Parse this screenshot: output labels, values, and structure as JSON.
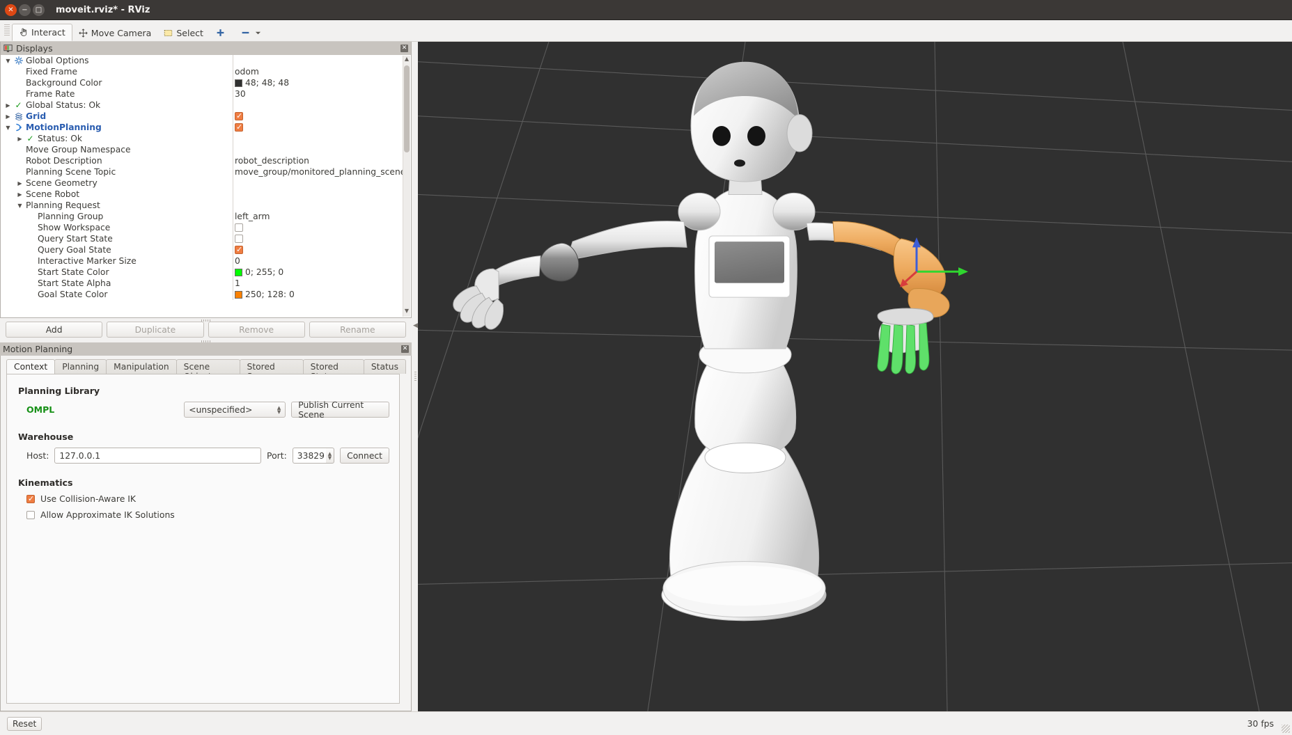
{
  "window": {
    "title": "moveit.rviz* - RViz",
    "close_icon": "close-icon",
    "minimize_icon": "minimize-icon",
    "maximize_icon": "maximize-icon"
  },
  "toolbar": {
    "items": [
      {
        "label": "Interact",
        "icon": "hand-cursor-icon",
        "active": true
      },
      {
        "label": "Move Camera",
        "icon": "move-camera-icon",
        "active": false
      },
      {
        "label": "Select",
        "icon": "select-rectangle-icon",
        "active": false
      },
      {
        "label": "",
        "icon": "plus-icon",
        "active": false
      },
      {
        "label": "",
        "icon": "minus-icon",
        "active": false
      }
    ]
  },
  "displays_panel": {
    "title": "Displays",
    "icon": "displays-icon",
    "close_icon": "close-icon",
    "rows": [
      {
        "indent": 0,
        "arrow": "down",
        "icon": "gear-icon",
        "label": "Global Options",
        "bold": false,
        "value_type": "none",
        "value": ""
      },
      {
        "indent": 1,
        "arrow": "none",
        "icon": "",
        "label": "Fixed Frame",
        "bold": false,
        "value_type": "text",
        "value": "odom"
      },
      {
        "indent": 1,
        "arrow": "none",
        "icon": "",
        "label": "Background Color",
        "bold": false,
        "value_type": "color",
        "value": "48; 48; 48",
        "color": "#303030"
      },
      {
        "indent": 1,
        "arrow": "none",
        "icon": "",
        "label": "Frame Rate",
        "bold": false,
        "value_type": "text",
        "value": "30"
      },
      {
        "indent": 0,
        "arrow": "right",
        "icon": "check-icon",
        "label": "Global Status: Ok",
        "bold": false,
        "value_type": "none",
        "value": ""
      },
      {
        "indent": 0,
        "arrow": "right",
        "icon": "grid-icon",
        "label": "Grid",
        "bold": true,
        "value_type": "checkbox",
        "value": "checked"
      },
      {
        "indent": 0,
        "arrow": "down",
        "icon": "motion-icon",
        "label": "MotionPlanning",
        "bold": true,
        "value_type": "checkbox",
        "value": "checked"
      },
      {
        "indent": 1,
        "arrow": "right",
        "icon": "check-icon",
        "label": "Status: Ok",
        "bold": false,
        "value_type": "none",
        "value": ""
      },
      {
        "indent": 1,
        "arrow": "none",
        "icon": "",
        "label": "Move Group Namespace",
        "bold": false,
        "value_type": "none",
        "value": ""
      },
      {
        "indent": 1,
        "arrow": "none",
        "icon": "",
        "label": "Robot Description",
        "bold": false,
        "value_type": "text",
        "value": "robot_description"
      },
      {
        "indent": 1,
        "arrow": "none",
        "icon": "",
        "label": "Planning Scene Topic",
        "bold": false,
        "value_type": "text",
        "value": "move_group/monitored_planning_scene"
      },
      {
        "indent": 1,
        "arrow": "right",
        "icon": "",
        "label": "Scene Geometry",
        "bold": false,
        "value_type": "none",
        "value": ""
      },
      {
        "indent": 1,
        "arrow": "right",
        "icon": "",
        "label": "Scene Robot",
        "bold": false,
        "value_type": "none",
        "value": ""
      },
      {
        "indent": 1,
        "arrow": "down",
        "icon": "",
        "label": "Planning Request",
        "bold": false,
        "value_type": "none",
        "value": ""
      },
      {
        "indent": 2,
        "arrow": "none",
        "icon": "",
        "label": "Planning Group",
        "bold": false,
        "value_type": "text",
        "value": "left_arm"
      },
      {
        "indent": 2,
        "arrow": "none",
        "icon": "",
        "label": "Show Workspace",
        "bold": false,
        "value_type": "checkbox",
        "value": "unchecked"
      },
      {
        "indent": 2,
        "arrow": "none",
        "icon": "",
        "label": "Query Start State",
        "bold": false,
        "value_type": "checkbox",
        "value": "unchecked"
      },
      {
        "indent": 2,
        "arrow": "none",
        "icon": "",
        "label": "Query Goal State",
        "bold": false,
        "value_type": "checkbox",
        "value": "checked"
      },
      {
        "indent": 2,
        "arrow": "none",
        "icon": "",
        "label": "Interactive Marker Size",
        "bold": false,
        "value_type": "text",
        "value": "0"
      },
      {
        "indent": 2,
        "arrow": "none",
        "icon": "",
        "label": "Start State Color",
        "bold": false,
        "value_type": "color",
        "value": "0; 255; 0",
        "color": "#00ff00"
      },
      {
        "indent": 2,
        "arrow": "none",
        "icon": "",
        "label": "Start State Alpha",
        "bold": false,
        "value_type": "text",
        "value": "1"
      },
      {
        "indent": 2,
        "arrow": "none",
        "icon": "",
        "label": "Goal State Color",
        "bold": false,
        "value_type": "color",
        "value": "250; 128: 0",
        "color": "#fa8000"
      }
    ]
  },
  "display_buttons": {
    "add": "Add",
    "duplicate": "Duplicate",
    "remove": "Remove",
    "rename": "Rename"
  },
  "motion_planning": {
    "title": "Motion Planning",
    "close_icon": "close-icon",
    "tabs": [
      {
        "label": "Context",
        "active": true
      },
      {
        "label": "Planning",
        "active": false
      },
      {
        "label": "Manipulation",
        "active": false
      },
      {
        "label": "Scene Objects",
        "active": false
      },
      {
        "label": "Stored Scenes",
        "active": false
      },
      {
        "label": "Stored States",
        "active": false
      },
      {
        "label": "Status",
        "active": false
      }
    ],
    "context": {
      "planning_library_heading": "Planning Library",
      "planning_library_name": "OMPL",
      "planner_select_value": "<unspecified>",
      "publish_scene_button": "Publish Current Scene",
      "warehouse_heading": "Warehouse",
      "host_label": "Host:",
      "host_value": "127.0.0.1",
      "port_label": "Port:",
      "port_value": "33829",
      "connect_button": "Connect",
      "kinematics_heading": "Kinematics",
      "use_collision_aware_ik": {
        "label": "Use Collision-Aware IK",
        "checked": true
      },
      "allow_approximate_ik": {
        "label": "Allow Approximate IK Solutions",
        "checked": false
      }
    }
  },
  "statusbar": {
    "reset_button": "Reset",
    "fps": "30 fps"
  },
  "viewport": {
    "background_color": "#303030",
    "grid_color": "#5a5a5a",
    "robot_name": "pepper-humanoid-robot",
    "goal_marker_color": "#fa8000",
    "axis_green": "#2fd62f"
  }
}
